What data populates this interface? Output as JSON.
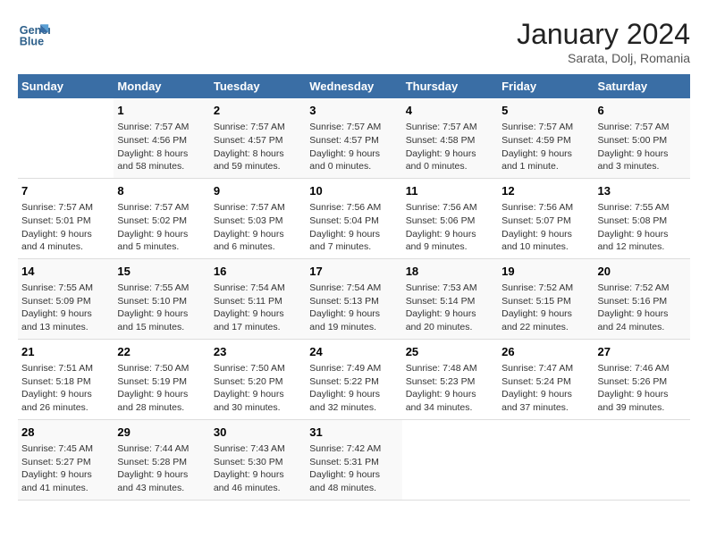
{
  "header": {
    "logo_line1": "General",
    "logo_line2": "Blue",
    "month": "January 2024",
    "location": "Sarata, Dolj, Romania"
  },
  "columns": [
    "Sunday",
    "Monday",
    "Tuesday",
    "Wednesday",
    "Thursday",
    "Friday",
    "Saturday"
  ],
  "rows": [
    [
      {
        "day": "",
        "info": ""
      },
      {
        "day": "1",
        "info": "Sunrise: 7:57 AM\nSunset: 4:56 PM\nDaylight: 8 hours\nand 58 minutes."
      },
      {
        "day": "2",
        "info": "Sunrise: 7:57 AM\nSunset: 4:57 PM\nDaylight: 8 hours\nand 59 minutes."
      },
      {
        "day": "3",
        "info": "Sunrise: 7:57 AM\nSunset: 4:57 PM\nDaylight: 9 hours\nand 0 minutes."
      },
      {
        "day": "4",
        "info": "Sunrise: 7:57 AM\nSunset: 4:58 PM\nDaylight: 9 hours\nand 0 minutes."
      },
      {
        "day": "5",
        "info": "Sunrise: 7:57 AM\nSunset: 4:59 PM\nDaylight: 9 hours\nand 1 minute."
      },
      {
        "day": "6",
        "info": "Sunrise: 7:57 AM\nSunset: 5:00 PM\nDaylight: 9 hours\nand 3 minutes."
      }
    ],
    [
      {
        "day": "7",
        "info": "Sunrise: 7:57 AM\nSunset: 5:01 PM\nDaylight: 9 hours\nand 4 minutes."
      },
      {
        "day": "8",
        "info": "Sunrise: 7:57 AM\nSunset: 5:02 PM\nDaylight: 9 hours\nand 5 minutes."
      },
      {
        "day": "9",
        "info": "Sunrise: 7:57 AM\nSunset: 5:03 PM\nDaylight: 9 hours\nand 6 minutes."
      },
      {
        "day": "10",
        "info": "Sunrise: 7:56 AM\nSunset: 5:04 PM\nDaylight: 9 hours\nand 7 minutes."
      },
      {
        "day": "11",
        "info": "Sunrise: 7:56 AM\nSunset: 5:06 PM\nDaylight: 9 hours\nand 9 minutes."
      },
      {
        "day": "12",
        "info": "Sunrise: 7:56 AM\nSunset: 5:07 PM\nDaylight: 9 hours\nand 10 minutes."
      },
      {
        "day": "13",
        "info": "Sunrise: 7:55 AM\nSunset: 5:08 PM\nDaylight: 9 hours\nand 12 minutes."
      }
    ],
    [
      {
        "day": "14",
        "info": "Sunrise: 7:55 AM\nSunset: 5:09 PM\nDaylight: 9 hours\nand 13 minutes."
      },
      {
        "day": "15",
        "info": "Sunrise: 7:55 AM\nSunset: 5:10 PM\nDaylight: 9 hours\nand 15 minutes."
      },
      {
        "day": "16",
        "info": "Sunrise: 7:54 AM\nSunset: 5:11 PM\nDaylight: 9 hours\nand 17 minutes."
      },
      {
        "day": "17",
        "info": "Sunrise: 7:54 AM\nSunset: 5:13 PM\nDaylight: 9 hours\nand 19 minutes."
      },
      {
        "day": "18",
        "info": "Sunrise: 7:53 AM\nSunset: 5:14 PM\nDaylight: 9 hours\nand 20 minutes."
      },
      {
        "day": "19",
        "info": "Sunrise: 7:52 AM\nSunset: 5:15 PM\nDaylight: 9 hours\nand 22 minutes."
      },
      {
        "day": "20",
        "info": "Sunrise: 7:52 AM\nSunset: 5:16 PM\nDaylight: 9 hours\nand 24 minutes."
      }
    ],
    [
      {
        "day": "21",
        "info": "Sunrise: 7:51 AM\nSunset: 5:18 PM\nDaylight: 9 hours\nand 26 minutes."
      },
      {
        "day": "22",
        "info": "Sunrise: 7:50 AM\nSunset: 5:19 PM\nDaylight: 9 hours\nand 28 minutes."
      },
      {
        "day": "23",
        "info": "Sunrise: 7:50 AM\nSunset: 5:20 PM\nDaylight: 9 hours\nand 30 minutes."
      },
      {
        "day": "24",
        "info": "Sunrise: 7:49 AM\nSunset: 5:22 PM\nDaylight: 9 hours\nand 32 minutes."
      },
      {
        "day": "25",
        "info": "Sunrise: 7:48 AM\nSunset: 5:23 PM\nDaylight: 9 hours\nand 34 minutes."
      },
      {
        "day": "26",
        "info": "Sunrise: 7:47 AM\nSunset: 5:24 PM\nDaylight: 9 hours\nand 37 minutes."
      },
      {
        "day": "27",
        "info": "Sunrise: 7:46 AM\nSunset: 5:26 PM\nDaylight: 9 hours\nand 39 minutes."
      }
    ],
    [
      {
        "day": "28",
        "info": "Sunrise: 7:45 AM\nSunset: 5:27 PM\nDaylight: 9 hours\nand 41 minutes."
      },
      {
        "day": "29",
        "info": "Sunrise: 7:44 AM\nSunset: 5:28 PM\nDaylight: 9 hours\nand 43 minutes."
      },
      {
        "day": "30",
        "info": "Sunrise: 7:43 AM\nSunset: 5:30 PM\nDaylight: 9 hours\nand 46 minutes."
      },
      {
        "day": "31",
        "info": "Sunrise: 7:42 AM\nSunset: 5:31 PM\nDaylight: 9 hours\nand 48 minutes."
      },
      {
        "day": "",
        "info": ""
      },
      {
        "day": "",
        "info": ""
      },
      {
        "day": "",
        "info": ""
      }
    ]
  ]
}
